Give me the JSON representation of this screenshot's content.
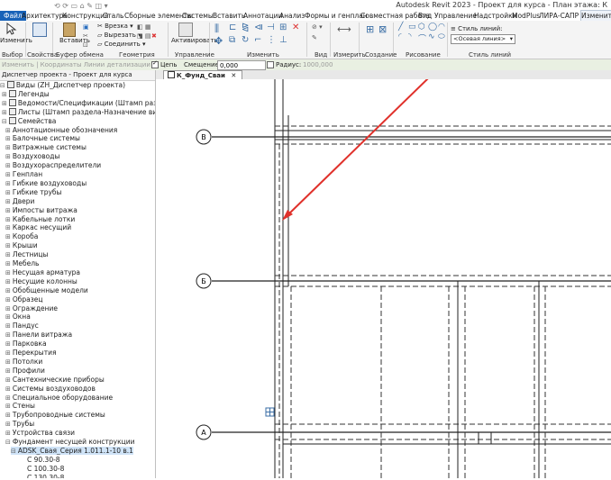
{
  "window": {
    "title": "Autodesk Revit 2023 - Проект для курса - План этажа: К"
  },
  "tabs": [
    "Файл",
    "Архитектура",
    "Конструкция",
    "Сталь",
    "Сборные элементы",
    "Системы",
    "Вставить",
    "Аннотации",
    "Анализ",
    "Формы и генплан",
    "Совместная работа",
    "Вид",
    "Управление",
    "Надстройки",
    "ModPlus",
    "ЛИРА-САПР",
    "Изменить | Л"
  ],
  "ribbon": {
    "modify_label": "Изменить",
    "paste_label": "Вставить",
    "cut_label": "Врезка",
    "cut2_label": "Вырезать",
    "join_label": "Соединить",
    "activate_label": "Активировать",
    "line_style_label": "Стиль линий:",
    "line_style_value": "<Осевая линия>",
    "panels": [
      "Выбор",
      "Свойства",
      "Буфер обмена",
      "Геометрия",
      "Управление",
      "Изменить",
      "Вид",
      "Измерить",
      "Создание",
      "Рисование",
      "Стиль линий"
    ]
  },
  "options_bar": {
    "mode_text": "Изменить | Координаты Линии детализации",
    "chain_label": "Цепь",
    "offset_label": "Смещение:",
    "offset_value": "0,000",
    "radius_label": "Радиус:",
    "radius_value": "1000,000"
  },
  "browser": {
    "title": "Диспетчер проекта - Проект для курса",
    "top_items": [
      "Виды (ZH_Диспетчер проекта)",
      "Легенды",
      "Ведомости/Спецификации (Штамп раздела-Назна",
      "Листы (Штамп раздела-Назначение вида)",
      "Семейства"
    ],
    "families": [
      "Аннотационные обозначения",
      "Балочные системы",
      "Витражные системы",
      "Воздуховоды",
      "Воздухораспределители",
      "Генплан",
      "Гибкие воздуховоды",
      "Гибкие трубы",
      "Двери",
      "Импосты витража",
      "Кабельные лотки",
      "Каркас несущий",
      "Короба",
      "Крыши",
      "Лестницы",
      "Мебель",
      "Несущая арматура",
      "Несущие колонны",
      "Обобщенные модели",
      "Образец",
      "Ограждение",
      "Окна",
      "Пандус",
      "Панели витража",
      "Парковка",
      "Перекрытия",
      "Потолки",
      "Профили",
      "Сантехнические приборы",
      "Системы воздуховодов",
      "Специальное оборудование",
      "Стены",
      "Трубопроводные системы",
      "Трубы",
      "Устройства связи",
      "Фундамент несущей конструкции"
    ],
    "selected_item": "ADSK_Свая_Серия 1.011.1-10 в.1",
    "sub_items": [
      "С 90.30-8",
      "С 100.30-8",
      "С 130.30-8"
    ]
  },
  "view": {
    "tab_label": "К_Фунд_Сваи",
    "grid_labels": [
      "В",
      "Б",
      "А"
    ]
  },
  "colors": {
    "accent": "#1862b8",
    "arrow": "#e0312b",
    "options_bar": "#e9f0e2"
  }
}
